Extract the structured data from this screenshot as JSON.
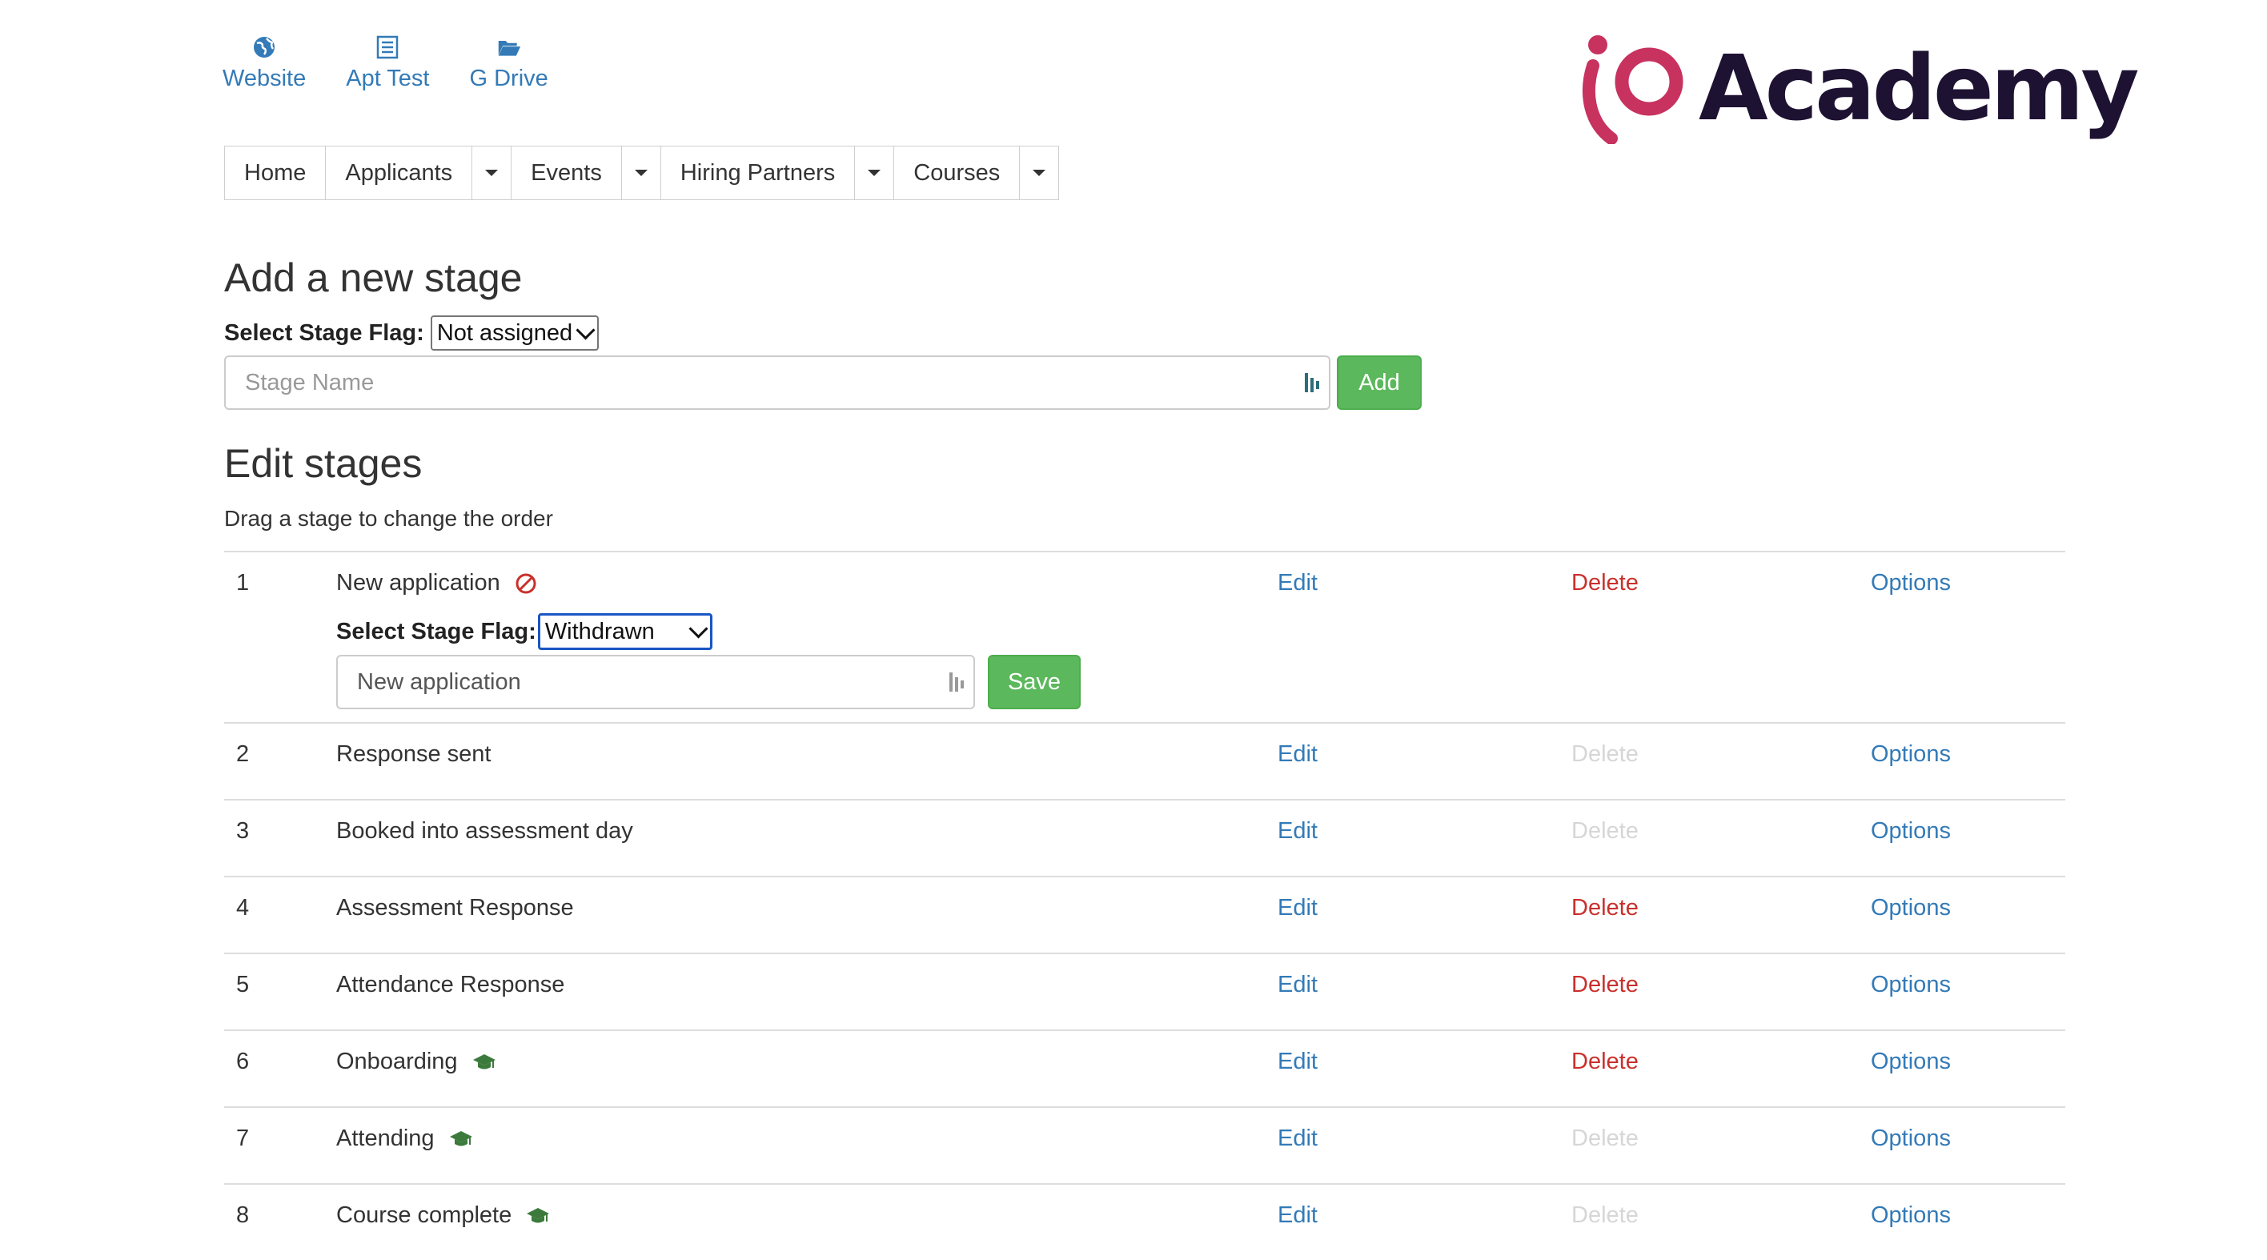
{
  "quicklinks": [
    {
      "label": "Website",
      "icon": "globe-icon"
    },
    {
      "label": "Apt Test",
      "icon": "list-icon"
    },
    {
      "label": "G Drive",
      "icon": "folder-open-icon"
    }
  ],
  "logo": {
    "text": "Academy",
    "mark_color": "#c7325f",
    "text_color": "#1e1232"
  },
  "nav": {
    "home": "Home",
    "applicants": "Applicants",
    "events": "Events",
    "hiring_partners": "Hiring Partners",
    "courses": "Courses"
  },
  "add_stage": {
    "title": "Add a new stage",
    "flag_label": "Select Stage Flag:",
    "flag_value": "Not assigned",
    "name_placeholder": "Stage Name",
    "add_button": "Add"
  },
  "edit_stages": {
    "title": "Edit stages",
    "hint": "Drag a stage to change the order",
    "edit_label": "Edit",
    "delete_label": "Delete",
    "options_label": "Options",
    "inline_editor": {
      "flag_label": "Select Stage Flag:",
      "flag_value": "Withdrawn",
      "name_value": "New application",
      "save_button": "Save"
    },
    "stages": [
      {
        "num": "1",
        "name": "New application",
        "flag_icon": "ban-icon",
        "delete_enabled": true
      },
      {
        "num": "2",
        "name": "Response sent",
        "flag_icon": null,
        "delete_enabled": false
      },
      {
        "num": "3",
        "name": "Booked into assessment day",
        "flag_icon": null,
        "delete_enabled": false
      },
      {
        "num": "4",
        "name": "Assessment Response",
        "flag_icon": null,
        "delete_enabled": true
      },
      {
        "num": "5",
        "name": "Attendance Response",
        "flag_icon": null,
        "delete_enabled": true
      },
      {
        "num": "6",
        "name": "Onboarding",
        "flag_icon": "graduation-cap-icon",
        "delete_enabled": true
      },
      {
        "num": "7",
        "name": "Attending",
        "flag_icon": "graduation-cap-icon",
        "delete_enabled": false
      },
      {
        "num": "8",
        "name": "Course complete",
        "flag_icon": "graduation-cap-icon",
        "delete_enabled": false
      }
    ]
  },
  "colors": {
    "link": "#337ab7",
    "danger": "#c9302c",
    "disabled": "#d6d6d6",
    "success": "#5cb85c",
    "flag_green": "#3c7a3c"
  }
}
